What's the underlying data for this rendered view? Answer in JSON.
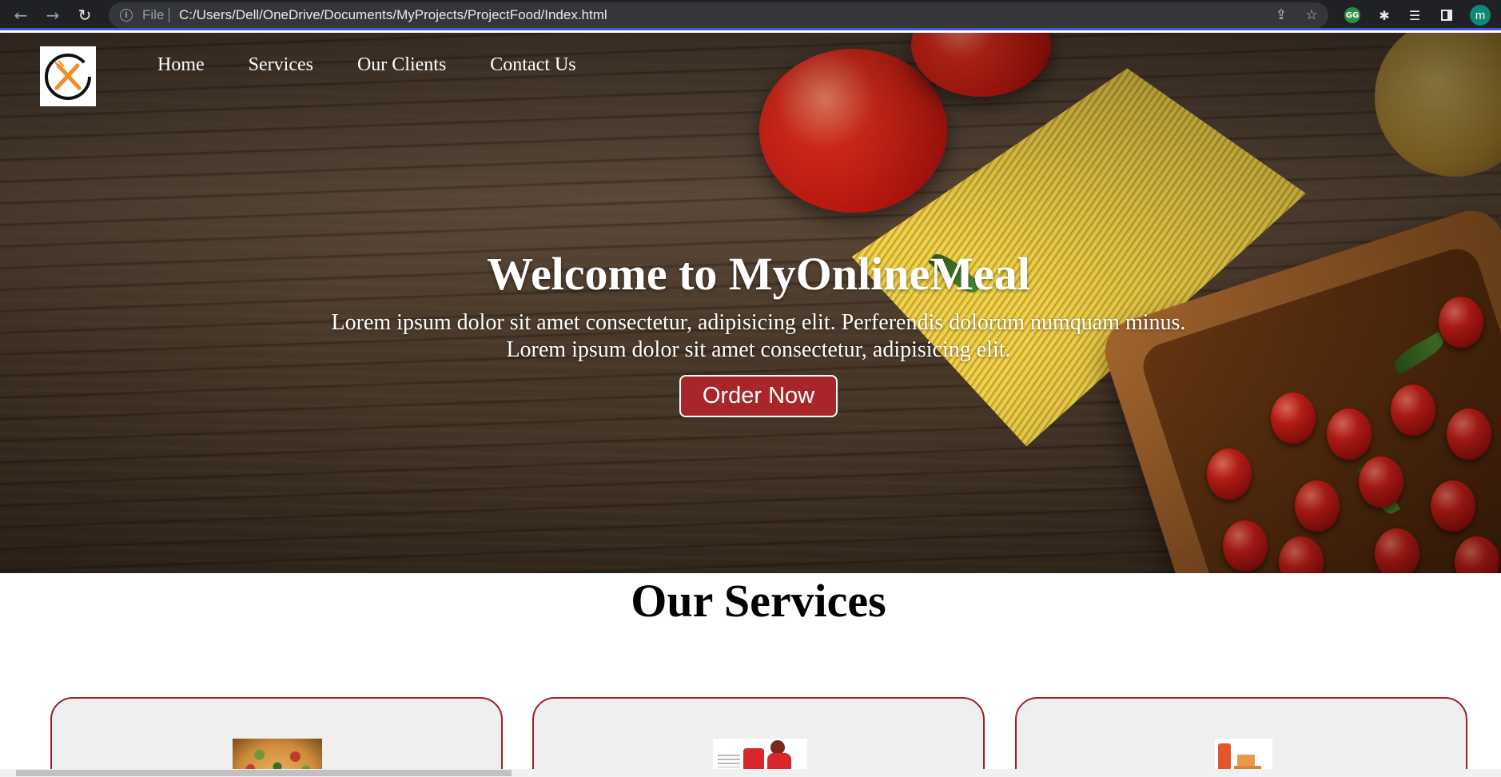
{
  "browser": {
    "back_icon": "←",
    "forward_icon": "→",
    "reload_icon": "↻",
    "scheme": "File",
    "url": "C:/Users/Dell/OneDrive/Documents/MyProjects/ProjectFood/Index.html",
    "profile_initial": "m"
  },
  "nav": {
    "items": [
      {
        "label": "Home"
      },
      {
        "label": "Services"
      },
      {
        "label": "Our Clients"
      },
      {
        "label": "Contact Us"
      }
    ]
  },
  "hero": {
    "title": "Welcome to MyOnlineMeal",
    "text_line1": "Lorem ipsum dolor sit amet consectetur, adipisicing elit. Perferendis dolorum numquam minus.",
    "text_line2": "Lorem ipsum dolor sit amet consectetur, adipisicing elit.",
    "cta": "Order Now"
  },
  "services": {
    "title": "Our Services",
    "cards": [
      {
        "image": "pizza-image"
      },
      {
        "image": "delivery-image"
      },
      {
        "image": "boxes-image"
      }
    ]
  },
  "colors": {
    "accent": "#a8262a",
    "card_border": "#a11f24",
    "logo_fork": "#f28c28"
  }
}
